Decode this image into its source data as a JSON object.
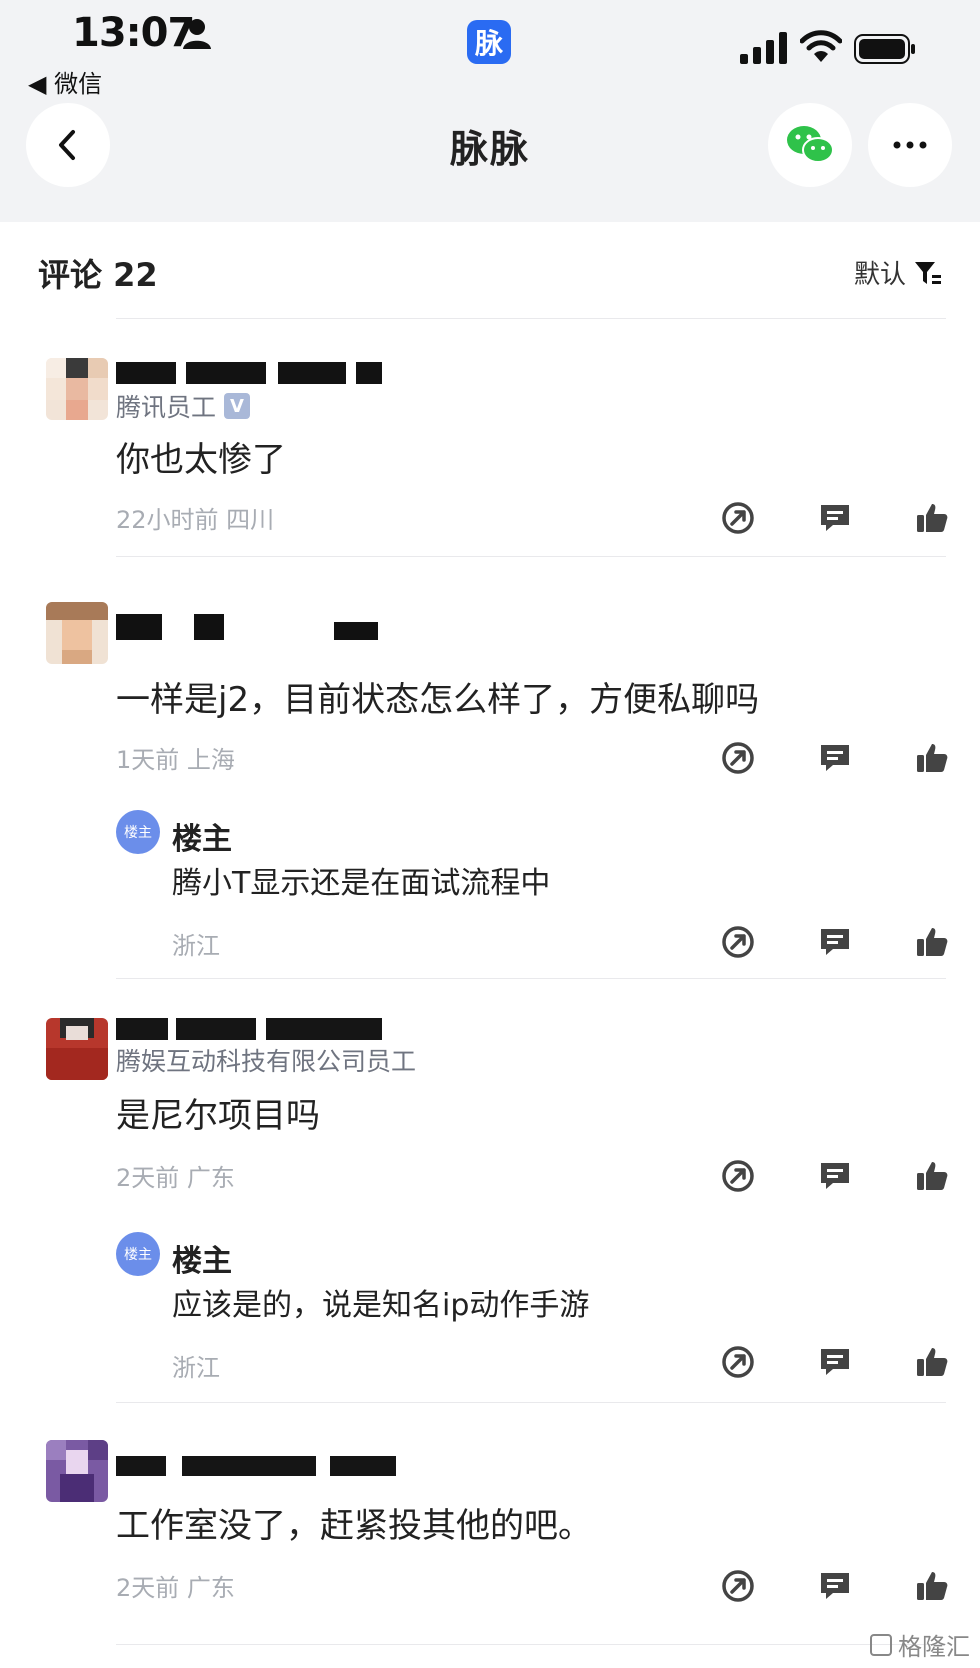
{
  "status_bar": {
    "time": "13:07",
    "app_badge": "脉",
    "back_app": "微信"
  },
  "nav": {
    "title": "脉脉"
  },
  "comments": {
    "title": "评论 22",
    "sort_label": "默认",
    "items": [
      {
        "company": "腾讯员工",
        "verify_mark": "V",
        "content": "你也太惨了",
        "meta": "22小时前  四川",
        "replies": []
      },
      {
        "company": "",
        "content": "一样是j2，目前状态怎么样了，方便私聊吗",
        "meta": "1天前  上海",
        "replies": [
          {
            "badge": "楼主",
            "name": "楼主",
            "text": "腾小T显示还是在面试流程中",
            "meta": "浙江"
          }
        ]
      },
      {
        "company": "腾娱互动科技有限公司员工",
        "content": "是尼尔项目吗",
        "meta": "2天前  广东",
        "replies": [
          {
            "badge": "楼主",
            "name": "楼主",
            "text": "应该是的，说是知名ip动作手游",
            "meta": "浙江"
          }
        ]
      },
      {
        "company": "",
        "content": "工作室没了，赶紧投其他的吧。",
        "meta": "2天前  广东",
        "replies": []
      }
    ]
  },
  "icons": [
    "person-icon",
    "signal-icon",
    "wifi-icon",
    "battery-icon",
    "back-icon",
    "wechat-icon",
    "more-icon",
    "filter-icon",
    "share-icon",
    "comment-icon",
    "like-icon"
  ],
  "watermark": "格隆汇"
}
